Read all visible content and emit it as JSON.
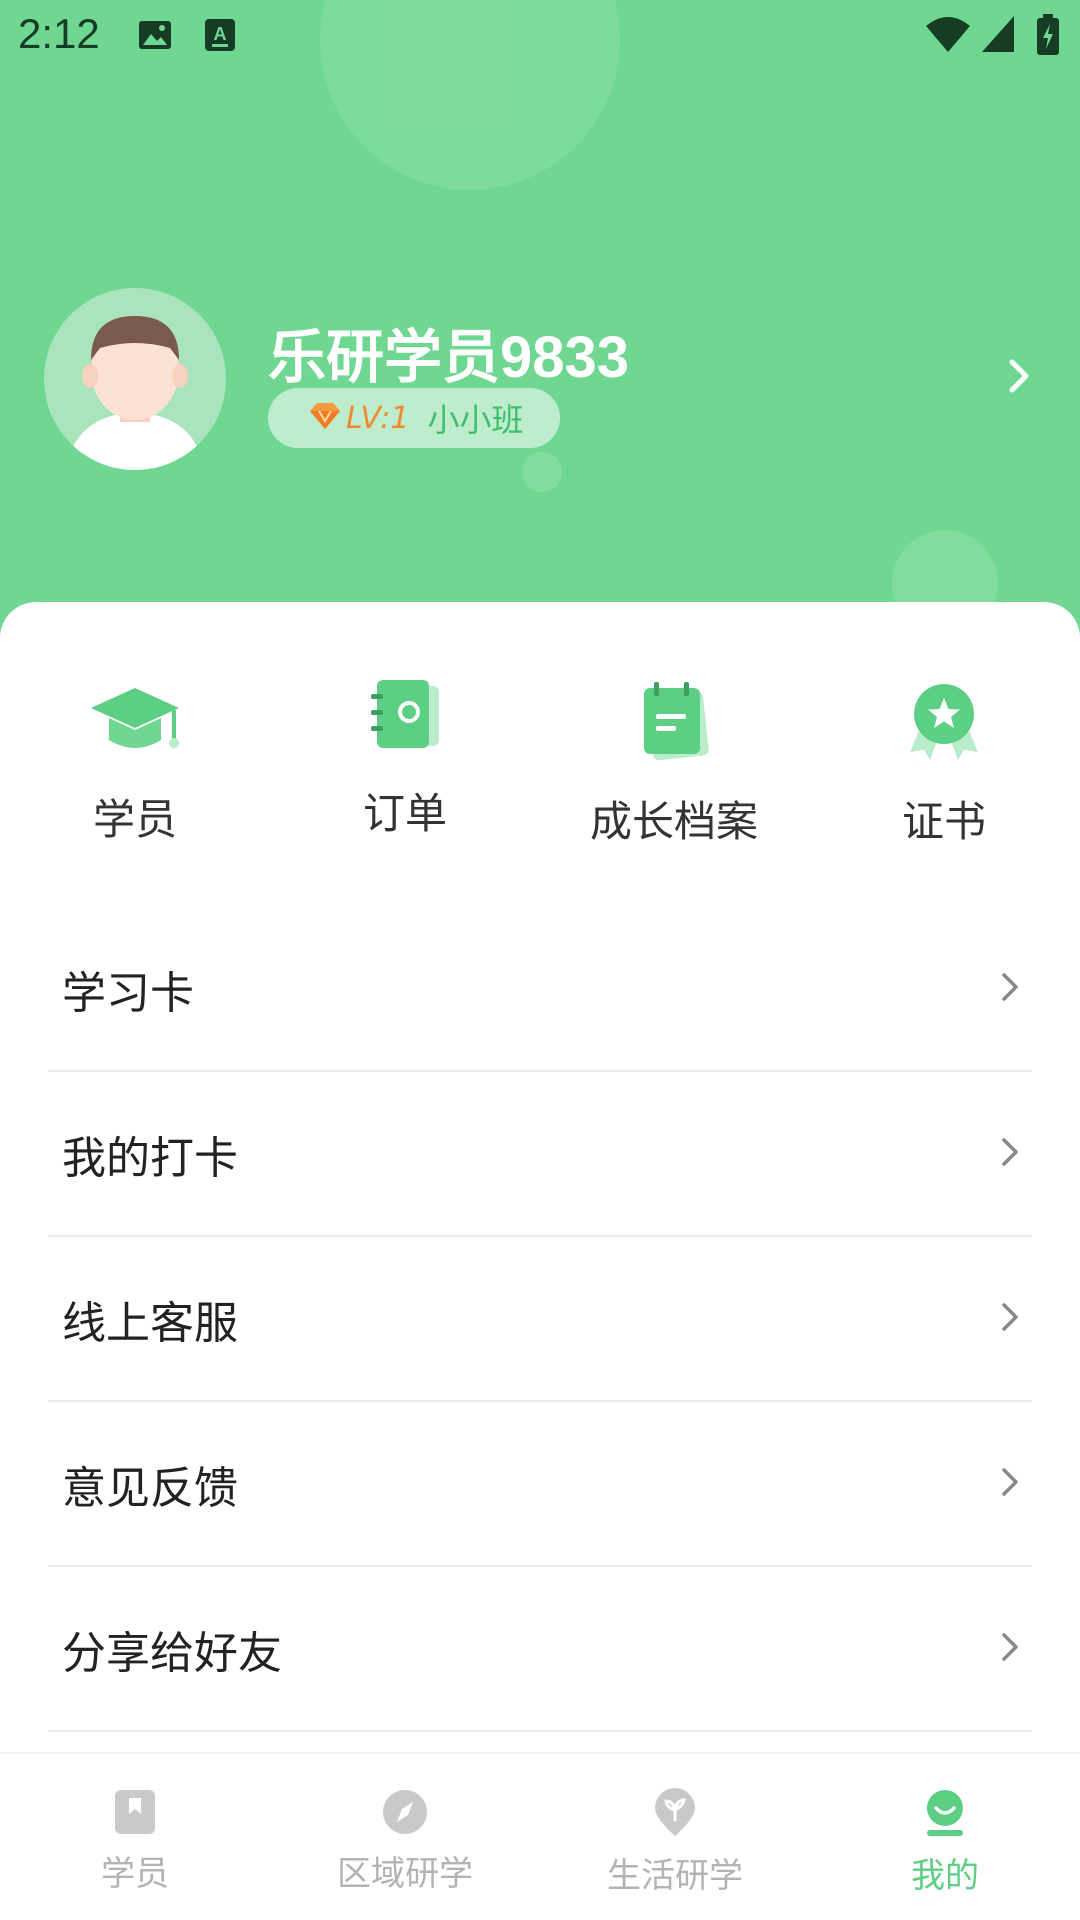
{
  "status_bar": {
    "time": "2:12"
  },
  "profile": {
    "username": "乐研学员9833",
    "level": "LV:1",
    "class_name": "小小班"
  },
  "quick_actions": [
    {
      "label": "学员",
      "icon": "graduation-cap-icon"
    },
    {
      "label": "订单",
      "icon": "order-book-icon"
    },
    {
      "label": "成长档案",
      "icon": "notepad-icon"
    },
    {
      "label": "证书",
      "icon": "award-ribbon-icon"
    }
  ],
  "menu": [
    {
      "label": "学习卡"
    },
    {
      "label": "我的打卡"
    },
    {
      "label": "线上客服"
    },
    {
      "label": "意见反馈"
    },
    {
      "label": "分享给好友"
    }
  ],
  "tabs": [
    {
      "label": "学员",
      "icon": "bookmark-icon",
      "active": false
    },
    {
      "label": "区域研学",
      "icon": "compass-icon",
      "active": false
    },
    {
      "label": "生活研学",
      "icon": "sprout-pin-icon",
      "active": false
    },
    {
      "label": "我的",
      "icon": "smiley-profile-icon",
      "active": true
    }
  ],
  "colors": {
    "header_green": "#6fd791",
    "accent_green": "#5ccf85",
    "level_orange": "#f08a32",
    "tab_inactive": "#b3b3b3"
  }
}
